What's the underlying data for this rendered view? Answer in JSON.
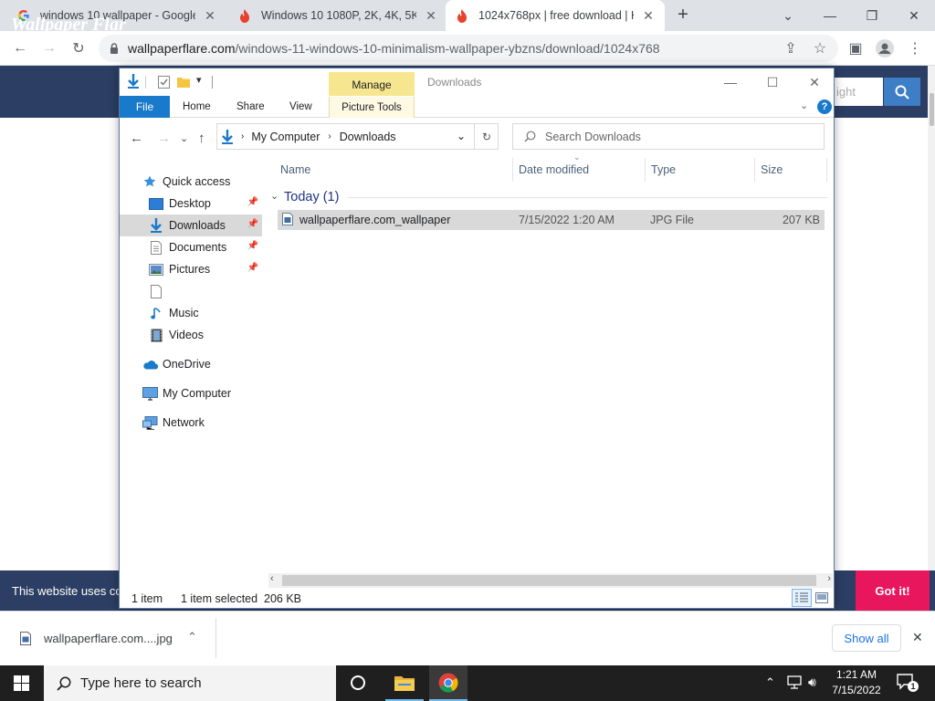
{
  "browser": {
    "tabs": [
      {
        "title": "windows 10 wallpaper - Google S"
      },
      {
        "title": "Windows 10 1080P, 2K, 4K, 5K HD"
      },
      {
        "title": "1024x768px | free download | HD"
      }
    ],
    "url_domain": "wallpaperflare.com",
    "url_path": "/windows-11-windows-10-minimalism-wallpaper-ybzns/download/1024x768"
  },
  "site": {
    "logo": "Wallpaper Flar",
    "search_placeholder": "ight",
    "cookie_text": "This website uses co",
    "cookie_button": "Got it!"
  },
  "explorer": {
    "context_tab": "Manage",
    "window_title": "Downloads",
    "ribbon_tabs": {
      "file": "File",
      "home": "Home",
      "share": "Share",
      "view": "View"
    },
    "picture_tools": "Picture Tools",
    "breadcrumb": [
      "My Computer",
      "Downloads"
    ],
    "search_placeholder": "Search Downloads",
    "nav": {
      "quick_access": "Quick access",
      "desktop": "Desktop",
      "downloads": "Downloads",
      "documents": "Documents",
      "pictures": "Pictures",
      "blank": "",
      "music": "Music",
      "videos": "Videos",
      "onedrive": "OneDrive",
      "my_computer": "My Computer",
      "network": "Network"
    },
    "columns": {
      "name": "Name",
      "date": "Date modified",
      "type": "Type",
      "size": "Size"
    },
    "group": "Today (1)",
    "files": [
      {
        "name": "wallpaperflare.com_wallpaper",
        "date": "7/15/2022 1:20 AM",
        "type": "JPG File",
        "size": "207 KB"
      }
    ],
    "status": {
      "count": "1 item",
      "selected": "1 item selected  206 KB"
    }
  },
  "download_shelf": {
    "file": "wallpaperflare.com....jpg",
    "show_all": "Show all"
  },
  "taskbar": {
    "search_placeholder": "Type here to search",
    "time": "1:21 AM",
    "date": "7/15/2022",
    "notifications": "1"
  },
  "colors": {
    "accent": "#1979ca",
    "site_header": "#2c3e63",
    "cookie_button": "#e8175d"
  }
}
